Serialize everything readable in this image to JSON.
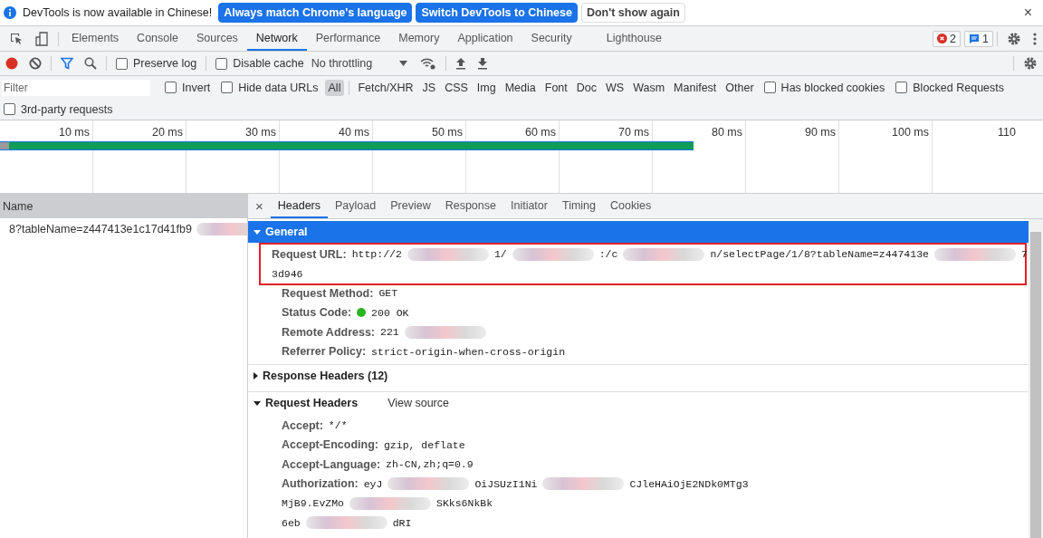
{
  "infobar": {
    "message": "DevTools is now available in Chinese!",
    "buttons": [
      {
        "label": "Always match Chrome's language",
        "kind": "primary"
      },
      {
        "label": "Switch DevTools to Chinese",
        "kind": "primary"
      },
      {
        "label": "Don't show again",
        "kind": "secondary"
      }
    ],
    "close": "×"
  },
  "panel_tabs": [
    {
      "label": "Elements",
      "selected": false
    },
    {
      "label": "Console",
      "selected": false
    },
    {
      "label": "Sources",
      "selected": false
    },
    {
      "label": "Network",
      "selected": true
    },
    {
      "label": "Performance",
      "selected": false
    },
    {
      "label": "Memory",
      "selected": false
    },
    {
      "label": "Application",
      "selected": false
    },
    {
      "label": "Security",
      "selected": false
    },
    {
      "label": "Lighthouse",
      "selected": false
    }
  ],
  "issues": {
    "errors": "2",
    "messages": "1"
  },
  "toolbar": {
    "recording": true,
    "preserve_log": {
      "label": "Preserve log",
      "checked": false
    },
    "disable_cache": {
      "label": "Disable cache",
      "checked": false
    },
    "throttling": "No throttling"
  },
  "filter": {
    "placeholder": "Filter",
    "invert": {
      "label": "Invert",
      "checked": false
    },
    "hide_data_urls": {
      "label": "Hide data URLs",
      "checked": false
    },
    "types": [
      {
        "label": "All",
        "selected": true
      },
      {
        "label": "Fetch/XHR",
        "selected": false
      },
      {
        "label": "JS",
        "selected": false
      },
      {
        "label": "CSS",
        "selected": false
      },
      {
        "label": "Img",
        "selected": false
      },
      {
        "label": "Media",
        "selected": false
      },
      {
        "label": "Font",
        "selected": false
      },
      {
        "label": "Doc",
        "selected": false
      },
      {
        "label": "WS",
        "selected": false
      },
      {
        "label": "Wasm",
        "selected": false
      },
      {
        "label": "Manifest",
        "selected": false
      },
      {
        "label": "Other",
        "selected": false
      }
    ],
    "has_blocked_cookies": {
      "label": "Has blocked cookies",
      "checked": false
    },
    "blocked_requests": {
      "label": "Blocked Requests",
      "checked": false
    },
    "third_party": {
      "label": "3rd-party requests",
      "checked": false
    }
  },
  "timeline": {
    "ticks": [
      "10 ms",
      "20 ms",
      "30 ms",
      "40 ms",
      "50 ms",
      "60 ms",
      "70 ms",
      "80 ms",
      "90 ms",
      "100 ms",
      "110"
    ],
    "level": 0.665
  },
  "requests": {
    "column": "Name",
    "rows": [
      {
        "name": "8?tableName=z447413e1c17d41fb9",
        "selected": false
      }
    ]
  },
  "detail_close": "×",
  "detail_tabs": [
    {
      "label": "Headers",
      "selected": true
    },
    {
      "label": "Payload",
      "selected": false
    },
    {
      "label": "Preview",
      "selected": false
    },
    {
      "label": "Response",
      "selected": false
    },
    {
      "label": "Initiator",
      "selected": false
    },
    {
      "label": "Timing",
      "selected": false
    },
    {
      "label": "Cookies",
      "selected": false
    }
  ],
  "sections": [
    {
      "title": "General",
      "expanded": true,
      "highlighted": true,
      "fields": [
        {
          "label": "Request URL:",
          "kind": "plain",
          "outlined": true,
          "lines": [
            [
              {
                "kind": "text",
                "text": "http://2"
              },
              {
                "kind": "blur"
              },
              {
                "kind": "text",
                "text": "1/"
              },
              {
                "kind": "blur"
              },
              {
                "kind": "text",
                "text": ":/c"
              },
              {
                "kind": "blur"
              },
              {
                "kind": "text",
                "text": "n/selectPage/1/8?tableName=z447413e"
              },
              {
                "kind": "blur"
              },
              {
                "kind": "text",
                "text": "7"
              }
            ],
            [
              {
                "kind": "text",
                "text": "3d946"
              }
            ]
          ]
        },
        {
          "label": "Request Method:",
          "kind": "plain",
          "outlined": false,
          "lines": [
            [
              {
                "kind": "text",
                "text": "GET"
              }
            ]
          ]
        },
        {
          "label": "Status Code:",
          "kind": "status",
          "outlined": false,
          "lines": [
            [
              {
                "kind": "text",
                "text": "200 OK"
              }
            ]
          ]
        },
        {
          "label": "Remote Address:",
          "kind": "plain",
          "outlined": false,
          "lines": [
            [
              {
                "kind": "text",
                "text": "221"
              },
              {
                "kind": "blur"
              }
            ]
          ]
        },
        {
          "label": "Referrer Policy:",
          "kind": "plain",
          "outlined": false,
          "lines": [
            [
              {
                "kind": "text",
                "text": "strict-origin-when-cross-origin"
              }
            ]
          ]
        }
      ]
    },
    {
      "title": "Response Headers (12)",
      "expanded": false,
      "highlighted": false
    },
    {
      "title": "Request Headers",
      "expanded": true,
      "highlighted": false,
      "link": "View source",
      "fields": [
        {
          "label": "Accept:",
          "kind": "plain",
          "outlined": false,
          "lines": [
            [
              {
                "kind": "text",
                "text": "*/*"
              }
            ]
          ]
        },
        {
          "label": "Accept-Encoding:",
          "kind": "plain",
          "outlined": false,
          "lines": [
            [
              {
                "kind": "text",
                "text": "gzip, deflate"
              }
            ]
          ]
        },
        {
          "label": "Accept-Language:",
          "kind": "plain",
          "outlined": false,
          "lines": [
            [
              {
                "kind": "text",
                "text": "zh-CN,zh;q=0.9"
              }
            ]
          ]
        },
        {
          "label": "Authorization:",
          "kind": "plain",
          "outlined": false,
          "lines": [
            [
              {
                "kind": "text",
                "text": "eyJ"
              },
              {
                "kind": "blur"
              },
              {
                "kind": "text",
                "text": "OiJSUzI1Ni"
              },
              {
                "kind": "blur"
              },
              {
                "kind": "text",
                "text": "CJleHAiOjE2NDk0MTg3"
              }
            ],
            [
              {
                "kind": "text",
                "text": "MjB9.EvZMo"
              },
              {
                "kind": "blur"
              },
              {
                "kind": "text",
                "text": "SKks6NkBk"
              }
            ],
            [
              {
                "kind": "text",
                "text": "6eb"
              },
              {
                "kind": "blur"
              },
              {
                "kind": "text",
                "text": "dRI"
              }
            ]
          ]
        }
      ]
    }
  ]
}
